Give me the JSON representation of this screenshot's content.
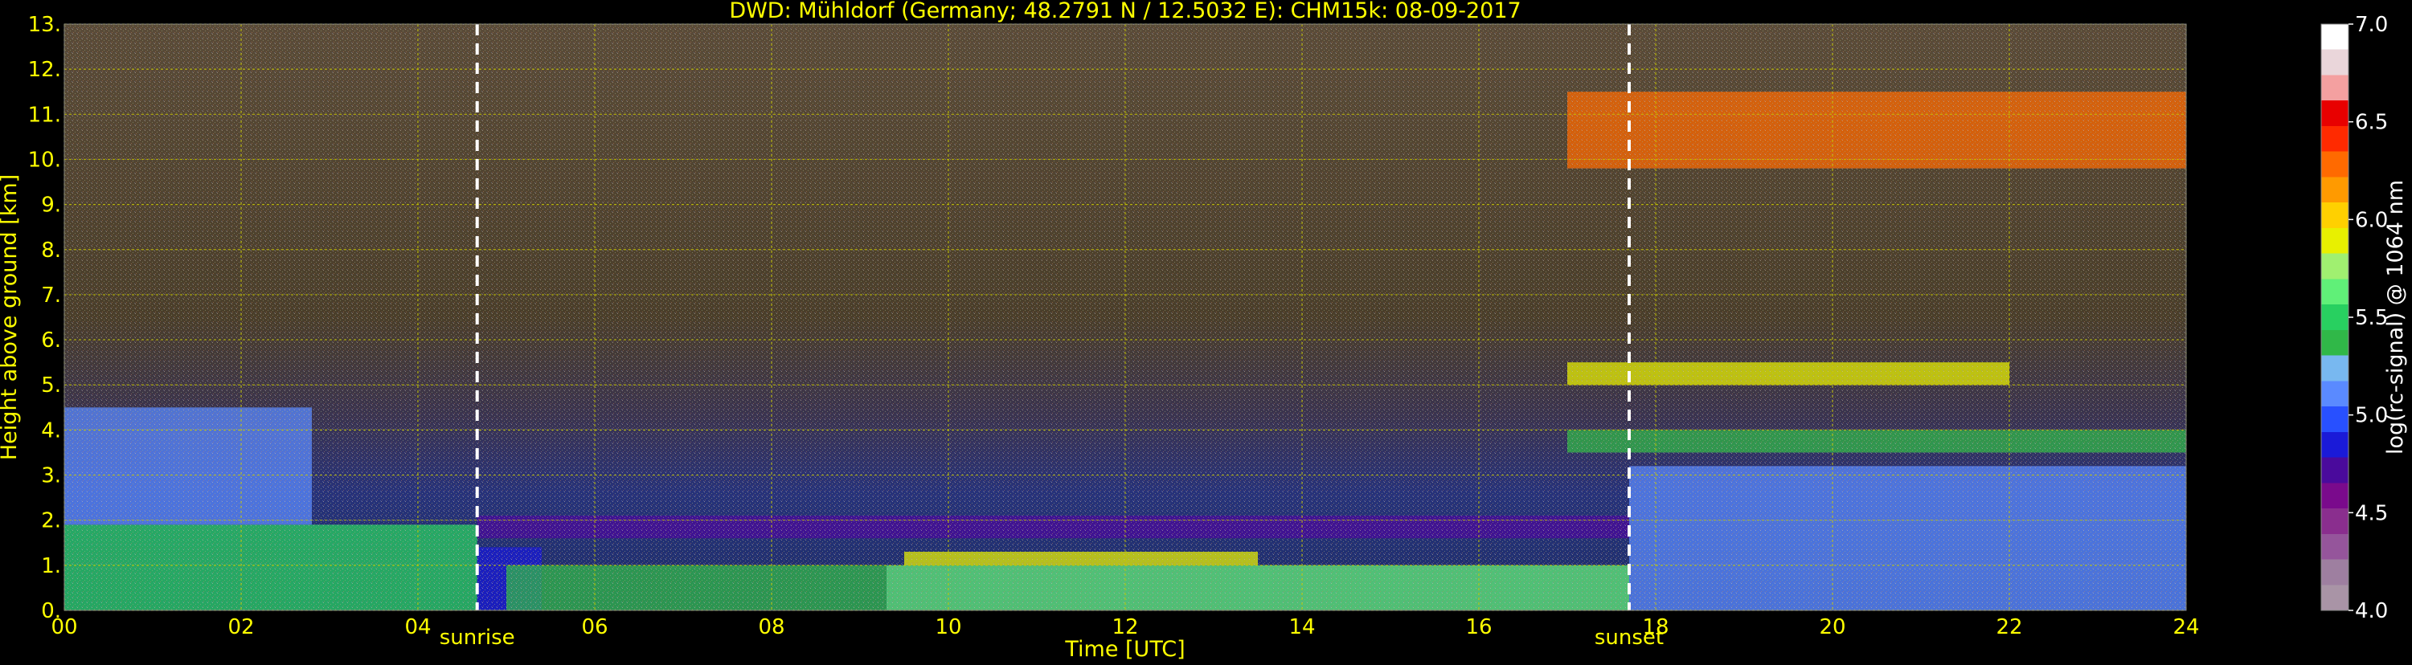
{
  "chart_data": {
    "type": "heatmap",
    "title": "DWD: Mühldorf (Germany; 48.2791 N / 12.5032 E):    CHM15k: 08-09-2017",
    "xlabel": "Time [UTC]",
    "ylabel": "Height above ground [km]",
    "colorbar_label": "log(rc-signal) @ 1064 nm",
    "xlim": [
      0,
      24
    ],
    "ylim": [
      0,
      13
    ],
    "x_ticks": [
      "00",
      "02",
      "04",
      "06",
      "08",
      "10",
      "12",
      "14",
      "16",
      "18",
      "20",
      "22",
      "24"
    ],
    "y_ticks": [
      "0.",
      "1.",
      "2.",
      "3.",
      "4.",
      "5.",
      "6.",
      "7.",
      "8.",
      "9.",
      "10.",
      "11.",
      "12.",
      "13."
    ],
    "colorbar_range": [
      4.0,
      7.0
    ],
    "colorbar_ticks": [
      "4.0",
      "4.5",
      "5.0",
      "5.5",
      "6.0",
      "6.5",
      "7.0"
    ],
    "colorbar_colors": [
      "#a994a6",
      "#9e7fa0",
      "#95559b",
      "#8a2e8e",
      "#7a0a8c",
      "#4a0a9c",
      "#1a1ad8",
      "#2850ff",
      "#5a8aff",
      "#78b8f0",
      "#30b848",
      "#28d060",
      "#60f078",
      "#a0f070",
      "#e8f000",
      "#ffd000",
      "#ff9a00",
      "#ff6a00",
      "#ff2a00",
      "#e80000",
      "#f4a0a0",
      "#ead6da",
      "#ffffff"
    ],
    "grid": true,
    "annotations": [
      {
        "label": "sunrise",
        "x": 4.67
      },
      {
        "label": "sunset",
        "x": 17.7
      }
    ],
    "layers": [
      {
        "x": [
          0,
          4.67
        ],
        "y": [
          0,
          1.9
        ],
        "level": 5.5
      },
      {
        "x": [
          0,
          2.8
        ],
        "y": [
          1.9,
          4.5
        ],
        "level": 5.05
      },
      {
        "x": [
          4.67,
          5.4
        ],
        "y": [
          0,
          1.4
        ],
        "level": 4.9
      },
      {
        "x": [
          5.0,
          9.3
        ],
        "y": [
          0,
          1.0
        ],
        "level": 5.4
      },
      {
        "x": [
          9.3,
          17.7
        ],
        "y": [
          0,
          1.0
        ],
        "level": 5.6
      },
      {
        "x": [
          9.5,
          13.5
        ],
        "y": [
          1.0,
          1.3
        ],
        "level": 5.9
      },
      {
        "x": [
          4.67,
          17.7
        ],
        "y": [
          1.6,
          2.1
        ],
        "level": 4.75
      },
      {
        "x": [
          17.7,
          24
        ],
        "y": [
          0,
          3.2
        ],
        "level": 5.1
      },
      {
        "x": [
          17.0,
          22.0
        ],
        "y": [
          5.0,
          5.5
        ],
        "level": 5.95
      },
      {
        "x": [
          17.0,
          24
        ],
        "y": [
          3.5,
          4.0
        ],
        "level": 5.4
      },
      {
        "x": [
          17.0,
          24
        ],
        "y": [
          9.8,
          11.5
        ],
        "level": 6.3
      }
    ]
  }
}
